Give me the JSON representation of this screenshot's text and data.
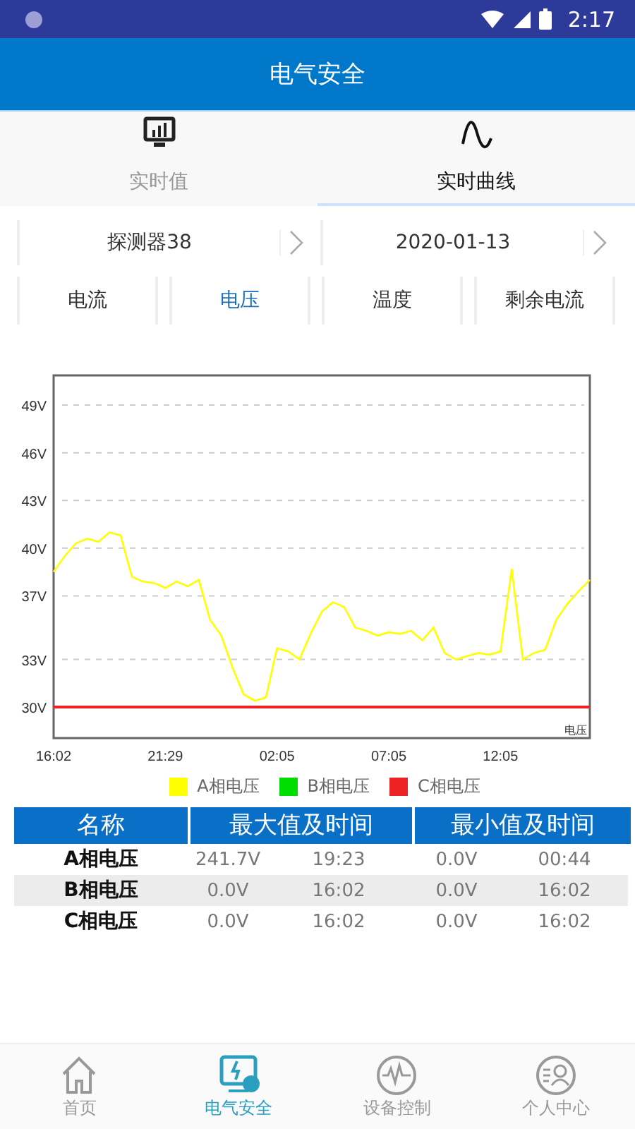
{
  "status_bar": {
    "time": "2:17"
  },
  "header": {
    "title": "电气安全"
  },
  "tabs": [
    {
      "label": "实时值",
      "selected": false
    },
    {
      "label": "实时曲线",
      "selected": true
    }
  ],
  "selectors": [
    {
      "value": "探测器38"
    },
    {
      "value": "2020-01-13"
    }
  ],
  "measure_tabs": [
    {
      "label": "电流",
      "selected": false
    },
    {
      "label": "电压",
      "selected": true
    },
    {
      "label": "温度",
      "selected": false
    },
    {
      "label": "剩余电流",
      "selected": false
    }
  ],
  "chart_data": {
    "type": "line",
    "ylabel": "电压",
    "categories": [
      "16:02",
      null,
      null,
      null,
      null,
      null,
      null,
      null,
      null,
      null,
      "21:29",
      null,
      null,
      null,
      null,
      null,
      null,
      null,
      null,
      null,
      "02:05",
      null,
      null,
      null,
      null,
      null,
      null,
      null,
      null,
      null,
      "07:05",
      null,
      null,
      null,
      null,
      null,
      null,
      null,
      null,
      null,
      "12:05",
      null,
      null,
      null,
      null,
      null,
      null,
      null,
      null
    ],
    "ylim": [
      28.05,
      50.87
    ],
    "grid": true,
    "yticks": [
      {
        "value": 30,
        "label": "30V"
      },
      {
        "value": 33,
        "label": "33V"
      },
      {
        "value": 37,
        "label": "37V"
      },
      {
        "value": 40,
        "label": "40V"
      },
      {
        "value": 43,
        "label": "43V"
      },
      {
        "value": 46,
        "label": "46V"
      },
      {
        "value": 49,
        "label": "49V"
      }
    ],
    "series": [
      {
        "name": "A相电压",
        "color": "#ffff00",
        "values": [
          38.5,
          39.5,
          40.3,
          40.6,
          40.4,
          41.0,
          40.8,
          38.2,
          37.9,
          37.8,
          37.5,
          37.9,
          37.6,
          38.0,
          35.5,
          34.5,
          32.5,
          30.8,
          30.4,
          30.6,
          33.7,
          33.5,
          33.0,
          34.6,
          36.0,
          36.6,
          36.3,
          35.0,
          34.8,
          34.5,
          34.7,
          34.6,
          34.8,
          34.2,
          35.0,
          33.4,
          33.0,
          33.2,
          33.4,
          33.3,
          33.5,
          38.7,
          33.0,
          33.4,
          33.6,
          35.5,
          36.5,
          37.3,
          38.0
        ]
      },
      {
        "name": "B相电压",
        "color": "#00dd00",
        "values": [
          null,
          null,
          null,
          null,
          null,
          null,
          null,
          null,
          null,
          null,
          null,
          null,
          null,
          null,
          null,
          null,
          null,
          null,
          null,
          null,
          null,
          null,
          null,
          null,
          null,
          null,
          null,
          null,
          null,
          null,
          null,
          null,
          null,
          null,
          null,
          null,
          null,
          null,
          null,
          null,
          null,
          null,
          null,
          null,
          null,
          null,
          null,
          null,
          null
        ]
      },
      {
        "name": "C相电压",
        "color": "#ee2222",
        "values": [
          30,
          30,
          30,
          30,
          30,
          30,
          30,
          30,
          30,
          30,
          30,
          30,
          30,
          30,
          30,
          30,
          30,
          30,
          30,
          30,
          30,
          30,
          30,
          30,
          30,
          30,
          30,
          30,
          30,
          30,
          30,
          30,
          30,
          30,
          30,
          30,
          30,
          30,
          30,
          30,
          30,
          30,
          30,
          30,
          30,
          30,
          30,
          30,
          30
        ]
      }
    ]
  },
  "table": {
    "columns": [
      "名称",
      "最大值及时间",
      "最小值及时间"
    ],
    "rows": [
      {
        "name": "A相电压",
        "max_value": "241.7V",
        "max_time": "19:23",
        "min_value": "0.0V",
        "min_time": "00:44"
      },
      {
        "name": "B相电压",
        "max_value": "0.0V",
        "max_time": "16:02",
        "min_value": "0.0V",
        "min_time": "16:02"
      },
      {
        "name": "C相电压",
        "max_value": "0.0V",
        "max_time": "16:02",
        "min_value": "0.0V",
        "min_time": "16:02"
      }
    ]
  },
  "bottom_nav": [
    {
      "label": "首页",
      "selected": false
    },
    {
      "label": "电气安全",
      "selected": true
    },
    {
      "label": "设备控制",
      "selected": false
    },
    {
      "label": "个人中心",
      "selected": false
    }
  ]
}
